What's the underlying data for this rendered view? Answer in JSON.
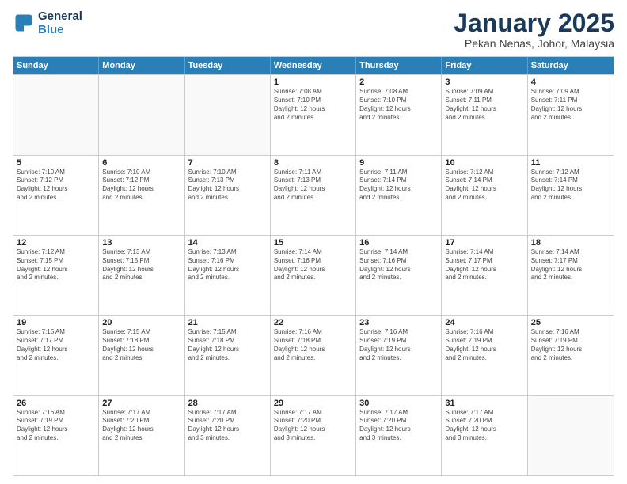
{
  "logo": {
    "line1": "General",
    "line2": "Blue"
  },
  "title": "January 2025",
  "location": "Pekan Nenas, Johor, Malaysia",
  "headers": [
    "Sunday",
    "Monday",
    "Tuesday",
    "Wednesday",
    "Thursday",
    "Friday",
    "Saturday"
  ],
  "rows": [
    [
      {
        "day": "",
        "info": ""
      },
      {
        "day": "",
        "info": ""
      },
      {
        "day": "",
        "info": ""
      },
      {
        "day": "1",
        "info": "Sunrise: 7:08 AM\nSunset: 7:10 PM\nDaylight: 12 hours\nand 2 minutes."
      },
      {
        "day": "2",
        "info": "Sunrise: 7:08 AM\nSunset: 7:10 PM\nDaylight: 12 hours\nand 2 minutes."
      },
      {
        "day": "3",
        "info": "Sunrise: 7:09 AM\nSunset: 7:11 PM\nDaylight: 12 hours\nand 2 minutes."
      },
      {
        "day": "4",
        "info": "Sunrise: 7:09 AM\nSunset: 7:11 PM\nDaylight: 12 hours\nand 2 minutes."
      }
    ],
    [
      {
        "day": "5",
        "info": "Sunrise: 7:10 AM\nSunset: 7:12 PM\nDaylight: 12 hours\nand 2 minutes."
      },
      {
        "day": "6",
        "info": "Sunrise: 7:10 AM\nSunset: 7:12 PM\nDaylight: 12 hours\nand 2 minutes."
      },
      {
        "day": "7",
        "info": "Sunrise: 7:10 AM\nSunset: 7:13 PM\nDaylight: 12 hours\nand 2 minutes."
      },
      {
        "day": "8",
        "info": "Sunrise: 7:11 AM\nSunset: 7:13 PM\nDaylight: 12 hours\nand 2 minutes."
      },
      {
        "day": "9",
        "info": "Sunrise: 7:11 AM\nSunset: 7:14 PM\nDaylight: 12 hours\nand 2 minutes."
      },
      {
        "day": "10",
        "info": "Sunrise: 7:12 AM\nSunset: 7:14 PM\nDaylight: 12 hours\nand 2 minutes."
      },
      {
        "day": "11",
        "info": "Sunrise: 7:12 AM\nSunset: 7:14 PM\nDaylight: 12 hours\nand 2 minutes."
      }
    ],
    [
      {
        "day": "12",
        "info": "Sunrise: 7:12 AM\nSunset: 7:15 PM\nDaylight: 12 hours\nand 2 minutes."
      },
      {
        "day": "13",
        "info": "Sunrise: 7:13 AM\nSunset: 7:15 PM\nDaylight: 12 hours\nand 2 minutes."
      },
      {
        "day": "14",
        "info": "Sunrise: 7:13 AM\nSunset: 7:16 PM\nDaylight: 12 hours\nand 2 minutes."
      },
      {
        "day": "15",
        "info": "Sunrise: 7:14 AM\nSunset: 7:16 PM\nDaylight: 12 hours\nand 2 minutes."
      },
      {
        "day": "16",
        "info": "Sunrise: 7:14 AM\nSunset: 7:16 PM\nDaylight: 12 hours\nand 2 minutes."
      },
      {
        "day": "17",
        "info": "Sunrise: 7:14 AM\nSunset: 7:17 PM\nDaylight: 12 hours\nand 2 minutes."
      },
      {
        "day": "18",
        "info": "Sunrise: 7:14 AM\nSunset: 7:17 PM\nDaylight: 12 hours\nand 2 minutes."
      }
    ],
    [
      {
        "day": "19",
        "info": "Sunrise: 7:15 AM\nSunset: 7:17 PM\nDaylight: 12 hours\nand 2 minutes."
      },
      {
        "day": "20",
        "info": "Sunrise: 7:15 AM\nSunset: 7:18 PM\nDaylight: 12 hours\nand 2 minutes."
      },
      {
        "day": "21",
        "info": "Sunrise: 7:15 AM\nSunset: 7:18 PM\nDaylight: 12 hours\nand 2 minutes."
      },
      {
        "day": "22",
        "info": "Sunrise: 7:16 AM\nSunset: 7:18 PM\nDaylight: 12 hours\nand 2 minutes."
      },
      {
        "day": "23",
        "info": "Sunrise: 7:16 AM\nSunset: 7:19 PM\nDaylight: 12 hours\nand 2 minutes."
      },
      {
        "day": "24",
        "info": "Sunrise: 7:16 AM\nSunset: 7:19 PM\nDaylight: 12 hours\nand 2 minutes."
      },
      {
        "day": "25",
        "info": "Sunrise: 7:16 AM\nSunset: 7:19 PM\nDaylight: 12 hours\nand 2 minutes."
      }
    ],
    [
      {
        "day": "26",
        "info": "Sunrise: 7:16 AM\nSunset: 7:19 PM\nDaylight: 12 hours\nand 2 minutes."
      },
      {
        "day": "27",
        "info": "Sunrise: 7:17 AM\nSunset: 7:20 PM\nDaylight: 12 hours\nand 2 minutes."
      },
      {
        "day": "28",
        "info": "Sunrise: 7:17 AM\nSunset: 7:20 PM\nDaylight: 12 hours\nand 3 minutes."
      },
      {
        "day": "29",
        "info": "Sunrise: 7:17 AM\nSunset: 7:20 PM\nDaylight: 12 hours\nand 3 minutes."
      },
      {
        "day": "30",
        "info": "Sunrise: 7:17 AM\nSunset: 7:20 PM\nDaylight: 12 hours\nand 3 minutes."
      },
      {
        "day": "31",
        "info": "Sunrise: 7:17 AM\nSunset: 7:20 PM\nDaylight: 12 hours\nand 3 minutes."
      },
      {
        "day": "",
        "info": ""
      }
    ]
  ]
}
